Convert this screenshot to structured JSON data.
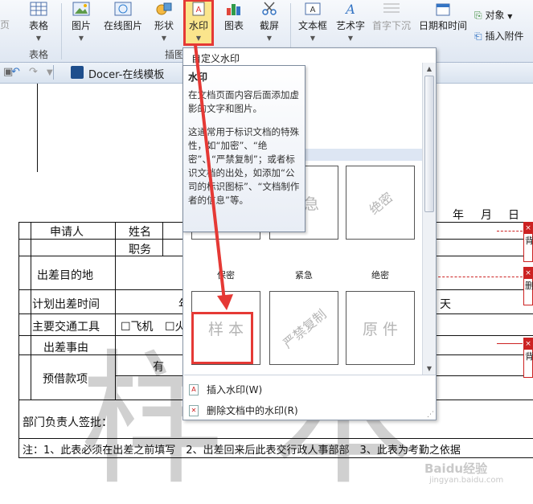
{
  "ribbon": {
    "partial_left": "页",
    "table": {
      "label": "表格",
      "group": "表格"
    },
    "picture": "图片",
    "online_picture": "在线图片",
    "shape": "形状",
    "picture_group_partial": "插图",
    "watermark": "水印",
    "chart": "图表",
    "screenshot": "截屏",
    "textbox": "文本框",
    "wordart": "艺术字",
    "dropcap": "首字下沉",
    "datetime": "日期和时间",
    "object": "对象",
    "attachment": "插入附件"
  },
  "quickbar": {
    "undo": "↶",
    "redo": "↷",
    "tab_title": "Docer-在线模板"
  },
  "panel": {
    "title": "自定义水印",
    "tiles_row1": [
      {
        "text": "",
        "label": "保密"
      },
      {
        "text": "紧急",
        "label": "紧急"
      },
      {
        "text": "绝密",
        "label": "绝密"
      }
    ],
    "tiles_row2": [
      {
        "text": "样 本",
        "label": ""
      },
      {
        "text": "严禁复制",
        "label": ""
      },
      {
        "text": "原 件",
        "label": ""
      }
    ],
    "insert": "插入水印(W)",
    "delete": "删除文档中的水印(R)"
  },
  "tooltip": {
    "title": "水印",
    "line1": "在文档页面内容后面添加虚影的文字和图片。",
    "line2": "这通常用于标识文档的特殊性，如“加密”、“绝密”、“严禁复制”；或者标识文档的出处，如添加“公司的标识图标”、“文档制作者的信息”等。"
  },
  "document": {
    "date": {
      "year": "年",
      "month": "月",
      "day": "日"
    },
    "applicant": "申请人",
    "name": "姓名",
    "position": "职务",
    "purpose": "出差目的地",
    "planned_time": "计划出差时间",
    "planned_time_partial": "年",
    "day_suffix": "天",
    "transport": "主要交通工具",
    "plane": "☐飞机",
    "other_transport": "☐火",
    "reason": "出差事由",
    "advance": "预借款项",
    "has": "有",
    "dept_sign": "部门负责人签批：",
    "note": "注：1、此表必须在出差之前填写　2、出差回来后此表交行政人事部部　3、此表为考勤之依据",
    "bg_watermark": "样 本",
    "callouts": [
      "背",
      "删",
      "背"
    ]
  },
  "footer_watermark": "Baidu经验",
  "footer_url": "jingyan.baidu.com"
}
